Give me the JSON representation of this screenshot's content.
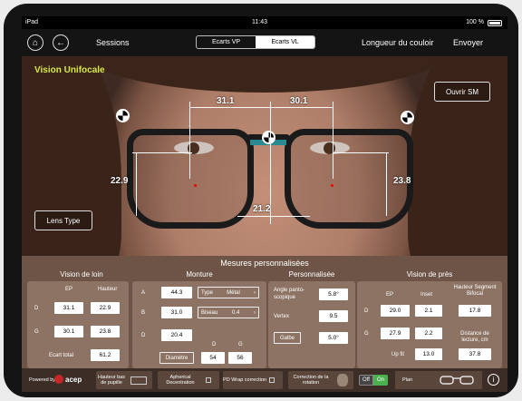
{
  "status": {
    "device": "iPad",
    "time": "11:43",
    "battery": "100 %"
  },
  "nav": {
    "sessions": "Sessions",
    "tabs": [
      "Ecarts VP",
      "Ecarts VL"
    ],
    "corridor": "Longueur du couloir",
    "send": "Envoyer"
  },
  "photo": {
    "title": "Vision Unifocale",
    "open_sm": "Ouvrir SM",
    "lens_type": "Lens Type",
    "measurements": {
      "pd_right": "31.1",
      "pd_left": "30.1",
      "height_right": "22.9",
      "height_left": "23.8",
      "bridge": "21.2"
    }
  },
  "panel": {
    "title": "Mesures personnalisées",
    "far": {
      "title": "Vision de loin",
      "col_ep": "EP",
      "col_height": "Hauteur",
      "row_d": "D",
      "row_g": "G",
      "d_ep": "31.1",
      "d_h": "22.9",
      "g_ep": "30.1",
      "g_h": "23.8",
      "total_label": "Ecart total",
      "total": "61.2"
    },
    "frame": {
      "title": "Monture",
      "a_label": "A",
      "a_value": "44.3",
      "b_label": "B",
      "b_value": "31.0",
      "d_label": "D",
      "d_value": "20.4",
      "type_label": "Type",
      "type_value": "Métal",
      "bevel_label": "Biseau",
      "bevel_value": "0.4",
      "diameter": "Diamètre",
      "dia_d_label": "D",
      "dia_g_label": "G",
      "dia_d": "54",
      "dia_g": "56"
    },
    "custom": {
      "title": "Personnalisée",
      "pantoscopic_label": "Angle panto-scopique",
      "pantoscopic": "5.8°",
      "vertex_label": "Vertex",
      "vertex": "9.5",
      "wrap_label": "Galbe",
      "wrap": "5.0°"
    },
    "near": {
      "title": "Vision de près",
      "col_ep": "EP",
      "col_inset": "Inset",
      "col_bifocal": "Hauteur Segment Bifocal",
      "row_d": "D",
      "row_g": "G",
      "d_ep": "29.0",
      "d_inset": "2.1",
      "bifocal": "17.8",
      "g_ep": "27.9",
      "g_inset": "2.2",
      "distance_label": "Distance de lecture, cm",
      "distance": "37.8",
      "upfit_label": "Up fit",
      "upfit": "13.0"
    }
  },
  "bottom": {
    "powered": "Powered by",
    "brand": "acep",
    "low_pupil": "Hauteur bas de pupille",
    "aspherical": "Apherical Decentration",
    "pd_wrap": "PD Wrap correction",
    "rotation": "Correction de la rotation",
    "off": "Off",
    "on": "On",
    "plan": "Plan",
    "info": "i"
  },
  "colors": {
    "accent_green": "#4caf50",
    "title_yellow": "#d8e84a",
    "panel_brown": "#6e5446"
  }
}
